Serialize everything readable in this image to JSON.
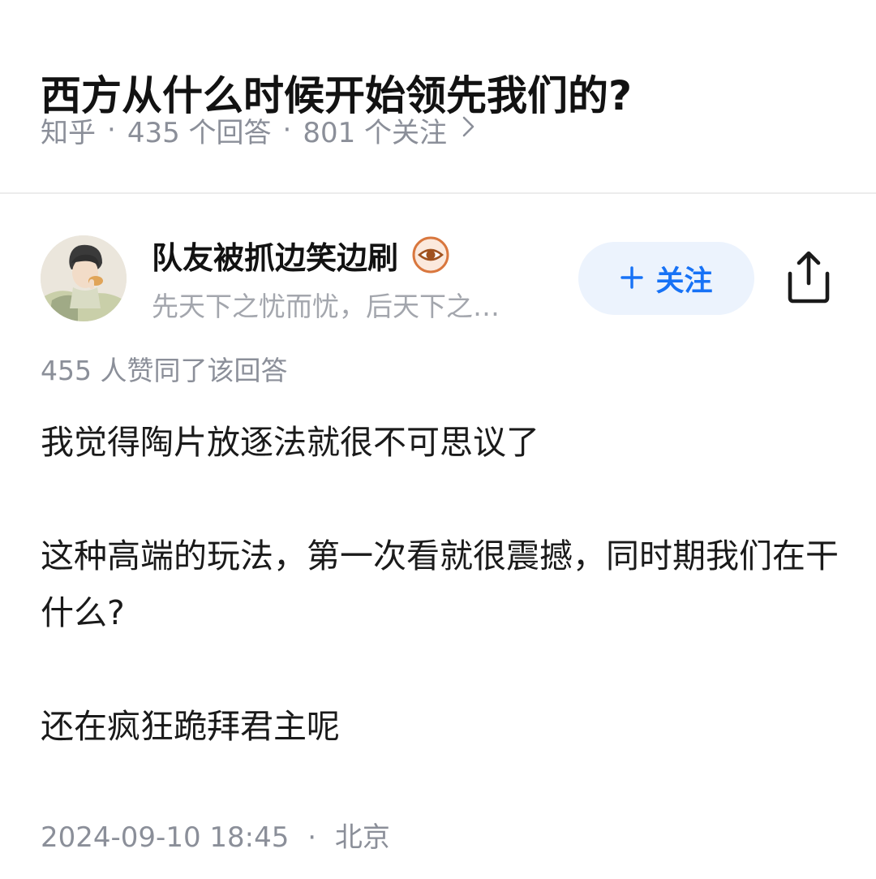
{
  "question": {
    "title": "西方从什么时候开始领先我们的?",
    "source": "知乎",
    "separator": "·",
    "answer_count": "435 个回答",
    "follower_count": "801 个关注",
    "chevron_icon": "chevron-right-icon"
  },
  "author": {
    "name": "队友被抓边笑边刷",
    "badge_icon": "eye-badge-icon",
    "bio": "先天下之忧而忧，后天下之…",
    "follow_label": "关注",
    "follow_icon": "plus-icon",
    "share_icon": "share-icon",
    "accent_color": "#1772f6"
  },
  "answer": {
    "vote_text": "455 人赞同了该回答",
    "paragraphs": [
      "我觉得陶片放逐法就很不可思议了",
      "这种高端的玩法，第一次看就很震撼，同时期我们在干什么?",
      "还在疯狂跪拜君主呢"
    ],
    "datetime": "2024-09-10 18:45",
    "separator": "·",
    "location": "北京"
  }
}
